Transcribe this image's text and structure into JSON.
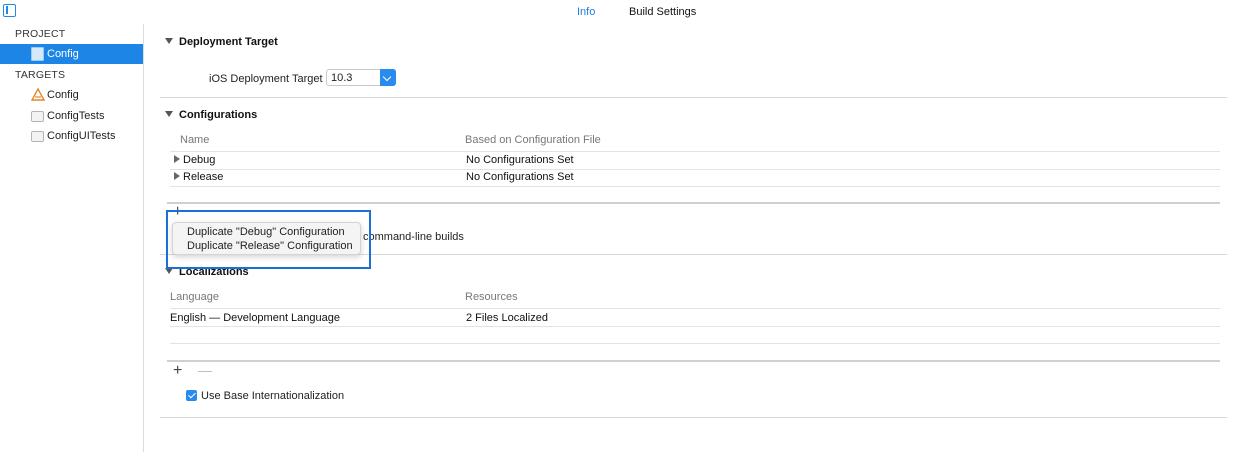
{
  "tabs": {
    "info": "Info",
    "build_settings": "Build Settings"
  },
  "sidebar": {
    "project_header": "PROJECT",
    "project_item": "Config",
    "targets_header": "TARGETS",
    "targets": [
      "Config",
      "ConfigTests",
      "ConfigUITests"
    ]
  },
  "deployment": {
    "title": "Deployment Target",
    "label": "iOS Deployment Target",
    "value": "10.3"
  },
  "configurations": {
    "title": "Configurations",
    "col_name": "Name",
    "col_based_on": "Based on Configuration File",
    "rows": [
      {
        "name": "Debug",
        "value": "No Configurations Set"
      },
      {
        "name": "Release",
        "value": "No Configurations Set"
      }
    ],
    "cmdline_text": "command-line builds"
  },
  "menu": {
    "items": [
      "Duplicate \"Debug\" Configuration",
      "Duplicate \"Release\" Configuration"
    ]
  },
  "localizations": {
    "title": "Localizations",
    "col_language": "Language",
    "col_resources": "Resources",
    "rows": [
      {
        "language": "English — Development Language",
        "resources": "2 Files Localized"
      }
    ],
    "use_base_label": "Use Base Internationalization",
    "use_base_checked": true
  },
  "controls": {
    "plus": "+",
    "minus": "—"
  },
  "colors": {
    "accent": "#1d85e6",
    "highlight_box": "#1a6fd8"
  }
}
